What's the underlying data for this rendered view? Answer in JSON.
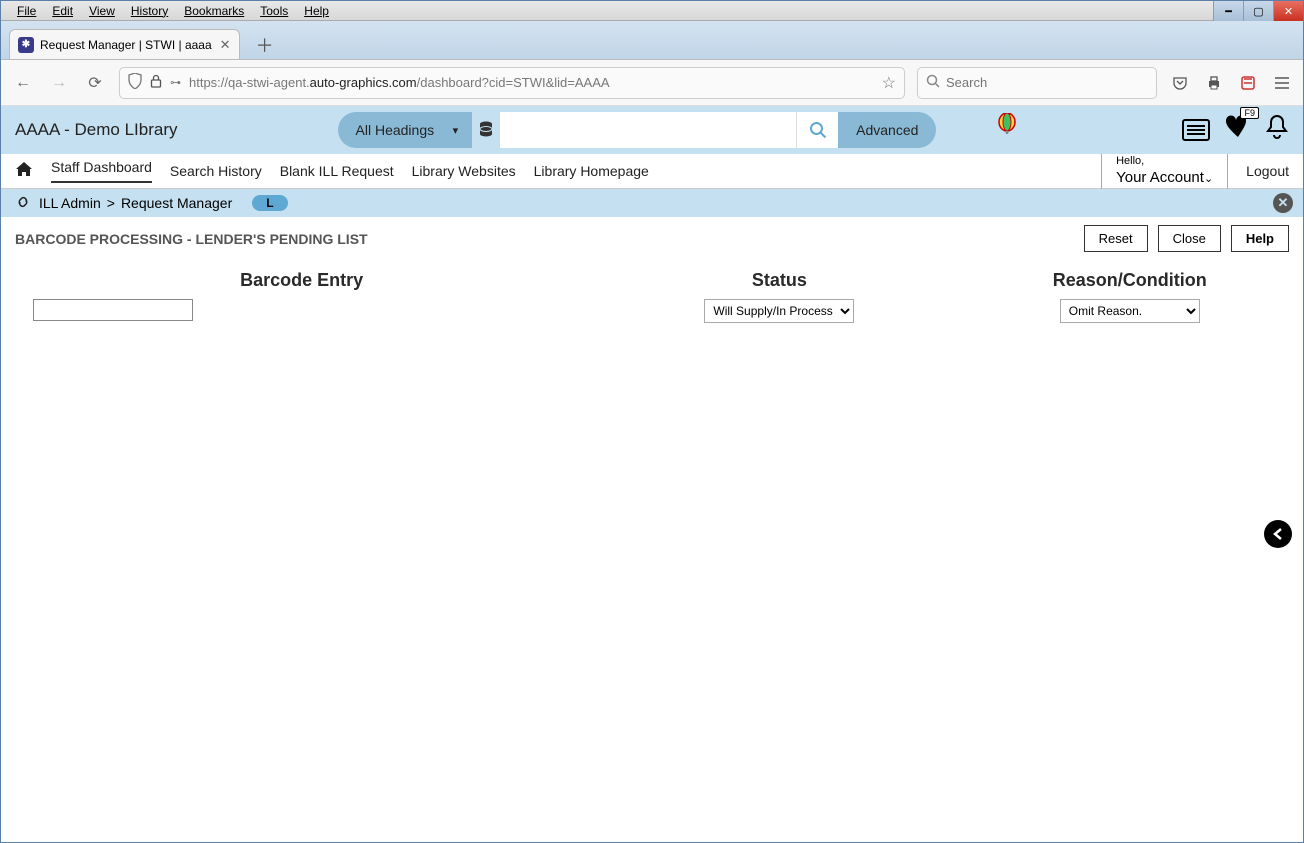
{
  "browser": {
    "menu": [
      "File",
      "Edit",
      "View",
      "History",
      "Bookmarks",
      "Tools",
      "Help"
    ],
    "tab_title": "Request Manager | STWI | aaaa",
    "url_prefix": "https://qa-stwi-agent.",
    "url_domain": "auto-graphics.com",
    "url_suffix": "/dashboard?cid=STWI&lid=AAAA",
    "search_placeholder": "Search"
  },
  "header": {
    "library_name": "AAAA - Demo LIbrary",
    "headings_label": "All Headings",
    "advanced_label": "Advanced",
    "heart_badge": "F9"
  },
  "nav": {
    "items": [
      "Staff Dashboard",
      "Search History",
      "Blank ILL Request",
      "Library Websites",
      "Library Homepage"
    ],
    "hello": "Hello,",
    "account": "Your Account",
    "logout": "Logout"
  },
  "breadcrumb": {
    "part1": "ILL Admin",
    "sep": ">",
    "part2": "Request Manager",
    "badge": "L"
  },
  "page": {
    "title": "BARCODE PROCESSING - LENDER'S PENDING LIST",
    "reset": "Reset",
    "close": "Close",
    "help": "Help"
  },
  "columns": {
    "barcode": "Barcode Entry",
    "status": "Status",
    "reason": "Reason/Condition"
  },
  "selects": {
    "status_value": "Will Supply/In Process",
    "reason_value": "Omit Reason."
  }
}
